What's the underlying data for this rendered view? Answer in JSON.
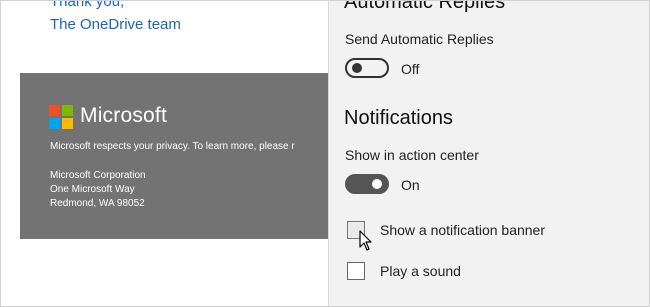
{
  "email": {
    "closing": [
      "Thank you,",
      "The OneDrive team"
    ],
    "footer": {
      "brand": "Microsoft",
      "privacy_text": "Microsoft respects your privacy. To learn more, please r",
      "address": [
        "Microsoft Corporation",
        "One Microsoft Way",
        "Redmond, WA 98052"
      ],
      "background_color": "#737373"
    },
    "link_color": "#1a66b5"
  },
  "settings": {
    "automatic_replies": {
      "heading": "Automatic Replies",
      "send_label": "Send Automatic Replies",
      "toggle_state": "Off"
    },
    "notifications": {
      "heading": "Notifications",
      "action_center_label": "Show in action center",
      "toggle_state": "On",
      "options": [
        {
          "label": "Show a notification banner",
          "checked": false
        },
        {
          "label": "Play a sound",
          "checked": false
        }
      ]
    },
    "panel_color": "#f2f2f2"
  }
}
